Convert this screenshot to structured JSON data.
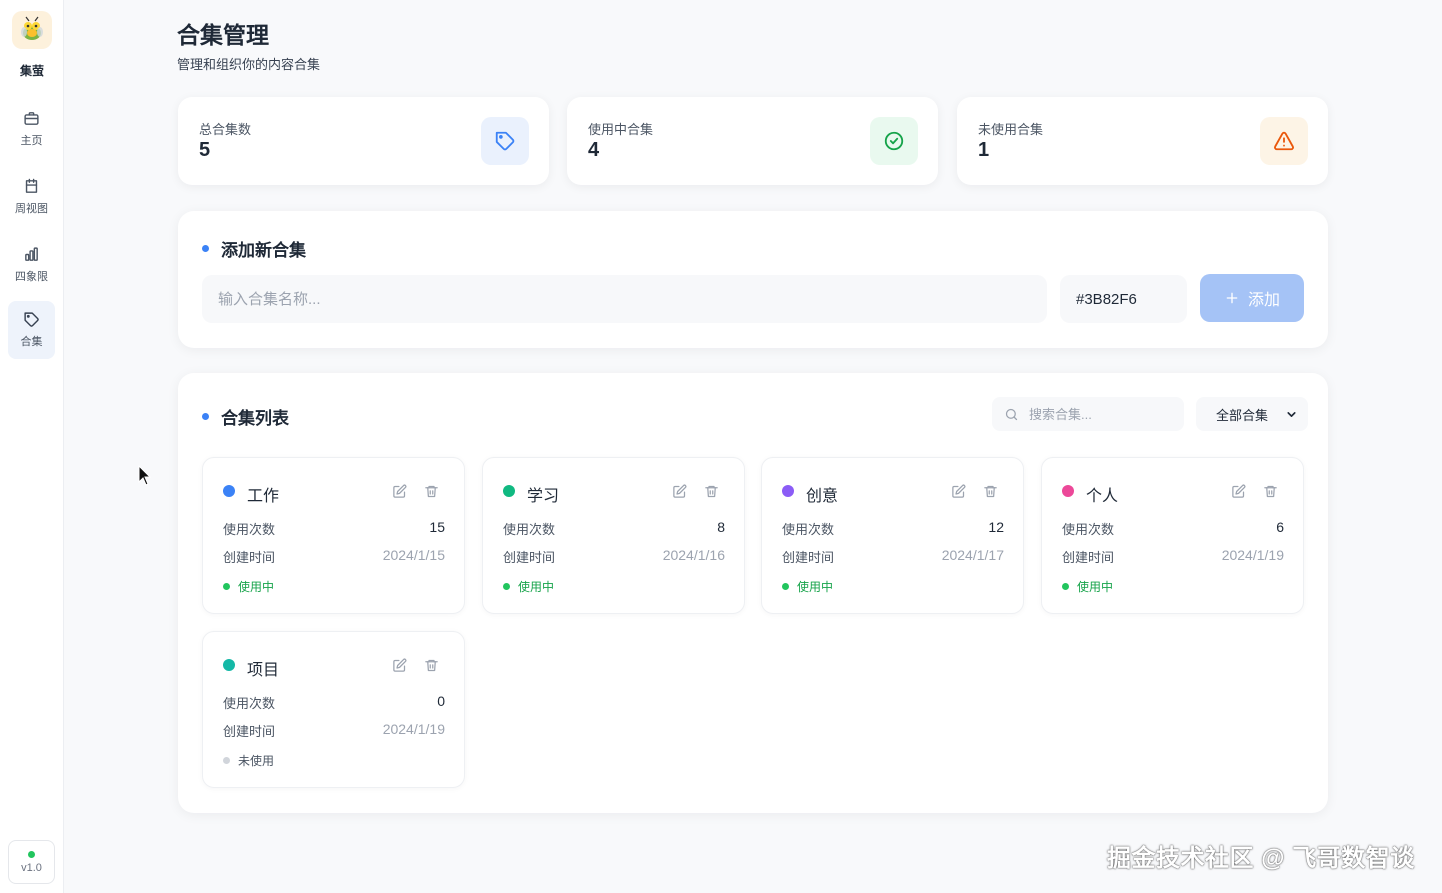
{
  "app": {
    "name": "集萤",
    "version": "v1.0"
  },
  "sidebar": {
    "items": [
      {
        "label": "主页",
        "icon": "briefcase-icon"
      },
      {
        "label": "周视图",
        "icon": "calendar-icon"
      },
      {
        "label": "四象限",
        "icon": "bar-chart-icon"
      },
      {
        "label": "合集",
        "icon": "tag-icon",
        "active": true
      }
    ]
  },
  "header": {
    "title": "合集管理",
    "subtitle": "管理和组织你的内容合集"
  },
  "stats": [
    {
      "label": "总合集数",
      "value": "5",
      "icon": "tag-icon",
      "color": "#3B82F6"
    },
    {
      "label": "使用中合集",
      "value": "4",
      "icon": "check-circle-icon",
      "color": "#16A34A"
    },
    {
      "label": "未使用合集",
      "value": "1",
      "icon": "warning-icon",
      "color": "#EA580C"
    }
  ],
  "add_panel": {
    "title": "添加新合集",
    "name_placeholder": "输入合集名称...",
    "color_value": "#3B82F6",
    "add_label": "添加"
  },
  "list_panel": {
    "title": "合集列表",
    "search_placeholder": "搜索合集...",
    "filter_value": "全部合集"
  },
  "labels": {
    "usage": "使用次数",
    "created": "创建时间"
  },
  "collections": [
    {
      "name": "工作",
      "color": "#3B82F6",
      "usage": "15",
      "created": "2024/1/15",
      "status": "使用中",
      "active": true
    },
    {
      "name": "学习",
      "color": "#10B981",
      "usage": "8",
      "created": "2024/1/16",
      "status": "使用中",
      "active": true
    },
    {
      "name": "创意",
      "color": "#8B5CF6",
      "usage": "12",
      "created": "2024/1/17",
      "status": "使用中",
      "active": true
    },
    {
      "name": "个人",
      "color": "#EC4899",
      "usage": "6",
      "created": "2024/1/19",
      "status": "使用中",
      "active": true
    },
    {
      "name": "项目",
      "color": "#14B8A6",
      "usage": "0",
      "created": "2024/1/19",
      "status": "未使用",
      "active": false
    }
  ],
  "watermark": "掘金技术社区 @ 飞哥数智谈"
}
